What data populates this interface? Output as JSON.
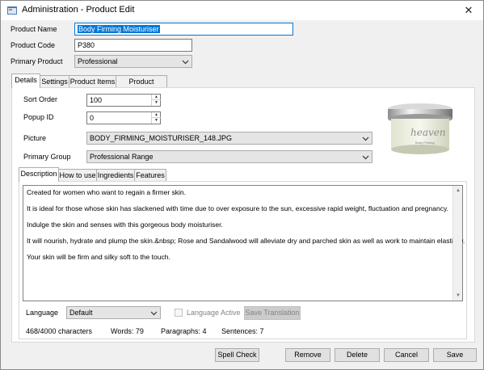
{
  "window": {
    "title": "Administration - Product Edit",
    "close_glyph": "✕"
  },
  "fields": {
    "product_name_label": "Product Name",
    "product_name_value": "Body Firming Moisturiser",
    "product_code_label": "Product Code",
    "product_code_value": "P380",
    "primary_product_label": "Primary Product",
    "primary_product_value": "Professional"
  },
  "main_tabs": [
    "Details",
    "Settings",
    "Product Items",
    "Product Groups"
  ],
  "details": {
    "sort_order_label": "Sort Order",
    "sort_order_value": "100",
    "popup_id_label": "Popup ID",
    "popup_id_value": "0",
    "picture_label": "Picture",
    "picture_value": "BODY_FIRMING_MOISTURISER_148.JPG",
    "primary_group_label": "Primary Group",
    "primary_group_value": "Professional Range",
    "product_image_brand": "heaven",
    "product_image_line": "Body Firming"
  },
  "desc_tabs": [
    "Description",
    "How to use",
    "Ingredients",
    "Features"
  ],
  "description": [
    "Created for women who want to regain a firmer skin.",
    "It is ideal for those whose skin has slackened with time due to over exposure to the sun, excessive rapid weight, fluctuation and pregnancy.",
    "Indulge the skin and senses with this gorgeous body moisturiser.",
    "It will nourish, hydrate and plump the skin.&nbsp; Rose and Sandalwood will alleviate dry and parched skin as well as work to maintain elasticity.",
    "Your skin will be firm and silky soft to the touch."
  ],
  "language": {
    "label": "Language",
    "value": "Default",
    "active_label": "Language Active",
    "save_translation": "Save Translation"
  },
  "stats": {
    "characters": "468/4000 characters",
    "words": "Words: 79",
    "paragraphs": "Paragraphs: 4",
    "sentences": "Sentences: 7"
  },
  "buttons": {
    "spell_check": "Spell Check",
    "remove": "Remove",
    "delete": "Delete",
    "cancel": "Cancel",
    "save": "Save"
  },
  "colors": {
    "selection": "#0078d7",
    "window_bg": "#f0f0f0",
    "border": "#acacac"
  }
}
